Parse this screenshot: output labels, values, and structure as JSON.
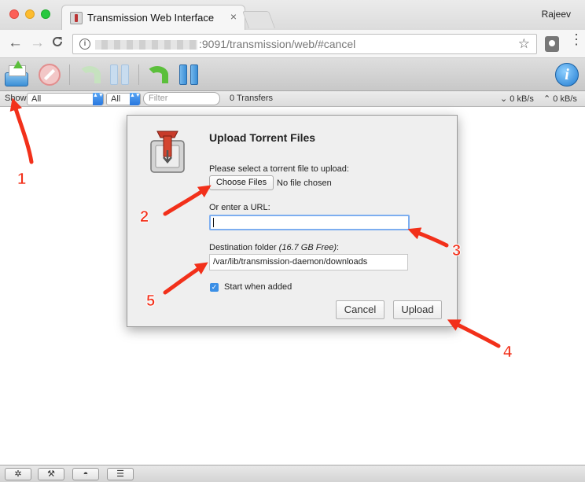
{
  "browser": {
    "tab_title": "Transmission Web Interface",
    "tab_close": "×",
    "profile_name": "Rajeev",
    "url_visible": ":9091/transmission/web/#cancel",
    "icons": {
      "back": "←",
      "forward": "→",
      "reload": "C",
      "info": "i",
      "star": "☆",
      "menu": "⋮"
    }
  },
  "toolbar": {
    "buttons": [
      "open-torrent",
      "remove-torrent",
      "resume-selected",
      "pause-selected",
      "resume-all",
      "pause-all",
      "inspector"
    ],
    "inspector_glyph": "i"
  },
  "filterbar": {
    "show_label": "Show",
    "state_filter": "All",
    "tracker_filter": "All",
    "filter_placeholder": "Filter",
    "transfers": "0 Transfers",
    "download_speed": "⌄ 0 kB/s",
    "upload_speed": "⌃ 0 kB/s",
    "chevron": "▲▼"
  },
  "dialog": {
    "title": "Upload Torrent Files",
    "file_label": "Please select a torrent file to upload:",
    "choose_button": "Choose Files",
    "no_file": "No file chosen",
    "url_label": "Or enter a URL:",
    "url_value": "",
    "dest_label": "Destination folder ",
    "dest_free": "(16.7 GB Free)",
    "dest_suffix": ":",
    "dest_value": "/var/lib/transmission-daemon/downloads",
    "start_checked_glyph": "✓",
    "start_label": "Start when added",
    "cancel_button": "Cancel",
    "upload_button": "Upload"
  },
  "annotations": {
    "colors": {
      "arrow": "#f2301a"
    },
    "labels": [
      "1",
      "2",
      "3",
      "4",
      "5"
    ]
  },
  "bottombar": {
    "gear": "✲",
    "wrench": "⚒",
    "turtle": "◓",
    "list": "☰"
  }
}
